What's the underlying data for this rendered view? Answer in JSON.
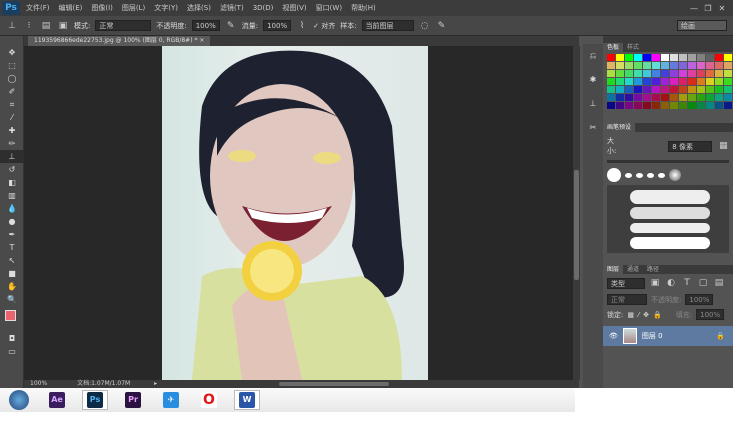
{
  "app": {
    "logo": "Ps"
  },
  "menu": [
    "文件(F)",
    "编辑(E)",
    "图像(I)",
    "图层(L)",
    "文字(Y)",
    "选择(S)",
    "滤镜(T)",
    "3D(D)",
    "视图(V)",
    "窗口(W)",
    "帮助(H)"
  ],
  "window_controls": {
    "minimize": "—",
    "restore": "❐",
    "close": "✕"
  },
  "options": {
    "mode_label": "模式:",
    "mode_value": "正常",
    "opacity_label": "不透明度:",
    "opacity_value": "100%",
    "flow_label": "流量:",
    "flow_value": "100%",
    "align_label": "对齐",
    "sample_label": "样本:",
    "sample_value": "当前图层",
    "workspace_value": "绘画"
  },
  "document": {
    "tab": "1193596866ede22753.jpg @ 100% (图层 0, RGB/8#) *",
    "zoom": "100%",
    "doc_info": "文档:1.07M/1.07M"
  },
  "swatches_panel": {
    "tabs": [
      "色板",
      "样式"
    ]
  },
  "brush_panel": {
    "title": "画笔预设",
    "size_label": "大小:",
    "size_value": "8 像素"
  },
  "layers_panel": {
    "tabs": [
      "图层",
      "通道",
      "路径"
    ],
    "filter": "类型",
    "blend": "正常",
    "opacity_label": "不透明度:",
    "opacity_value": "100%",
    "lock_label": "锁定:",
    "fill_label": "填充:",
    "fill_value": "100%",
    "layers": [
      {
        "name": "图层 0"
      }
    ]
  },
  "taskbar": {
    "apps": [
      {
        "name": "Ae",
        "color": "#3a1d5c",
        "fg": "#d6a6ff"
      },
      {
        "name": "Ps",
        "color": "#0d2a44",
        "fg": "#4ab0f0"
      },
      {
        "name": "Pr",
        "color": "#2b1240",
        "fg": "#e6a0ff"
      },
      {
        "name": "✈",
        "color": "#2a8ee0",
        "fg": "#fff"
      },
      {
        "name": "O",
        "color": "#fff",
        "fg": "#e01818"
      },
      {
        "name": "W",
        "color": "#2a56a8",
        "fg": "#fff"
      }
    ]
  }
}
